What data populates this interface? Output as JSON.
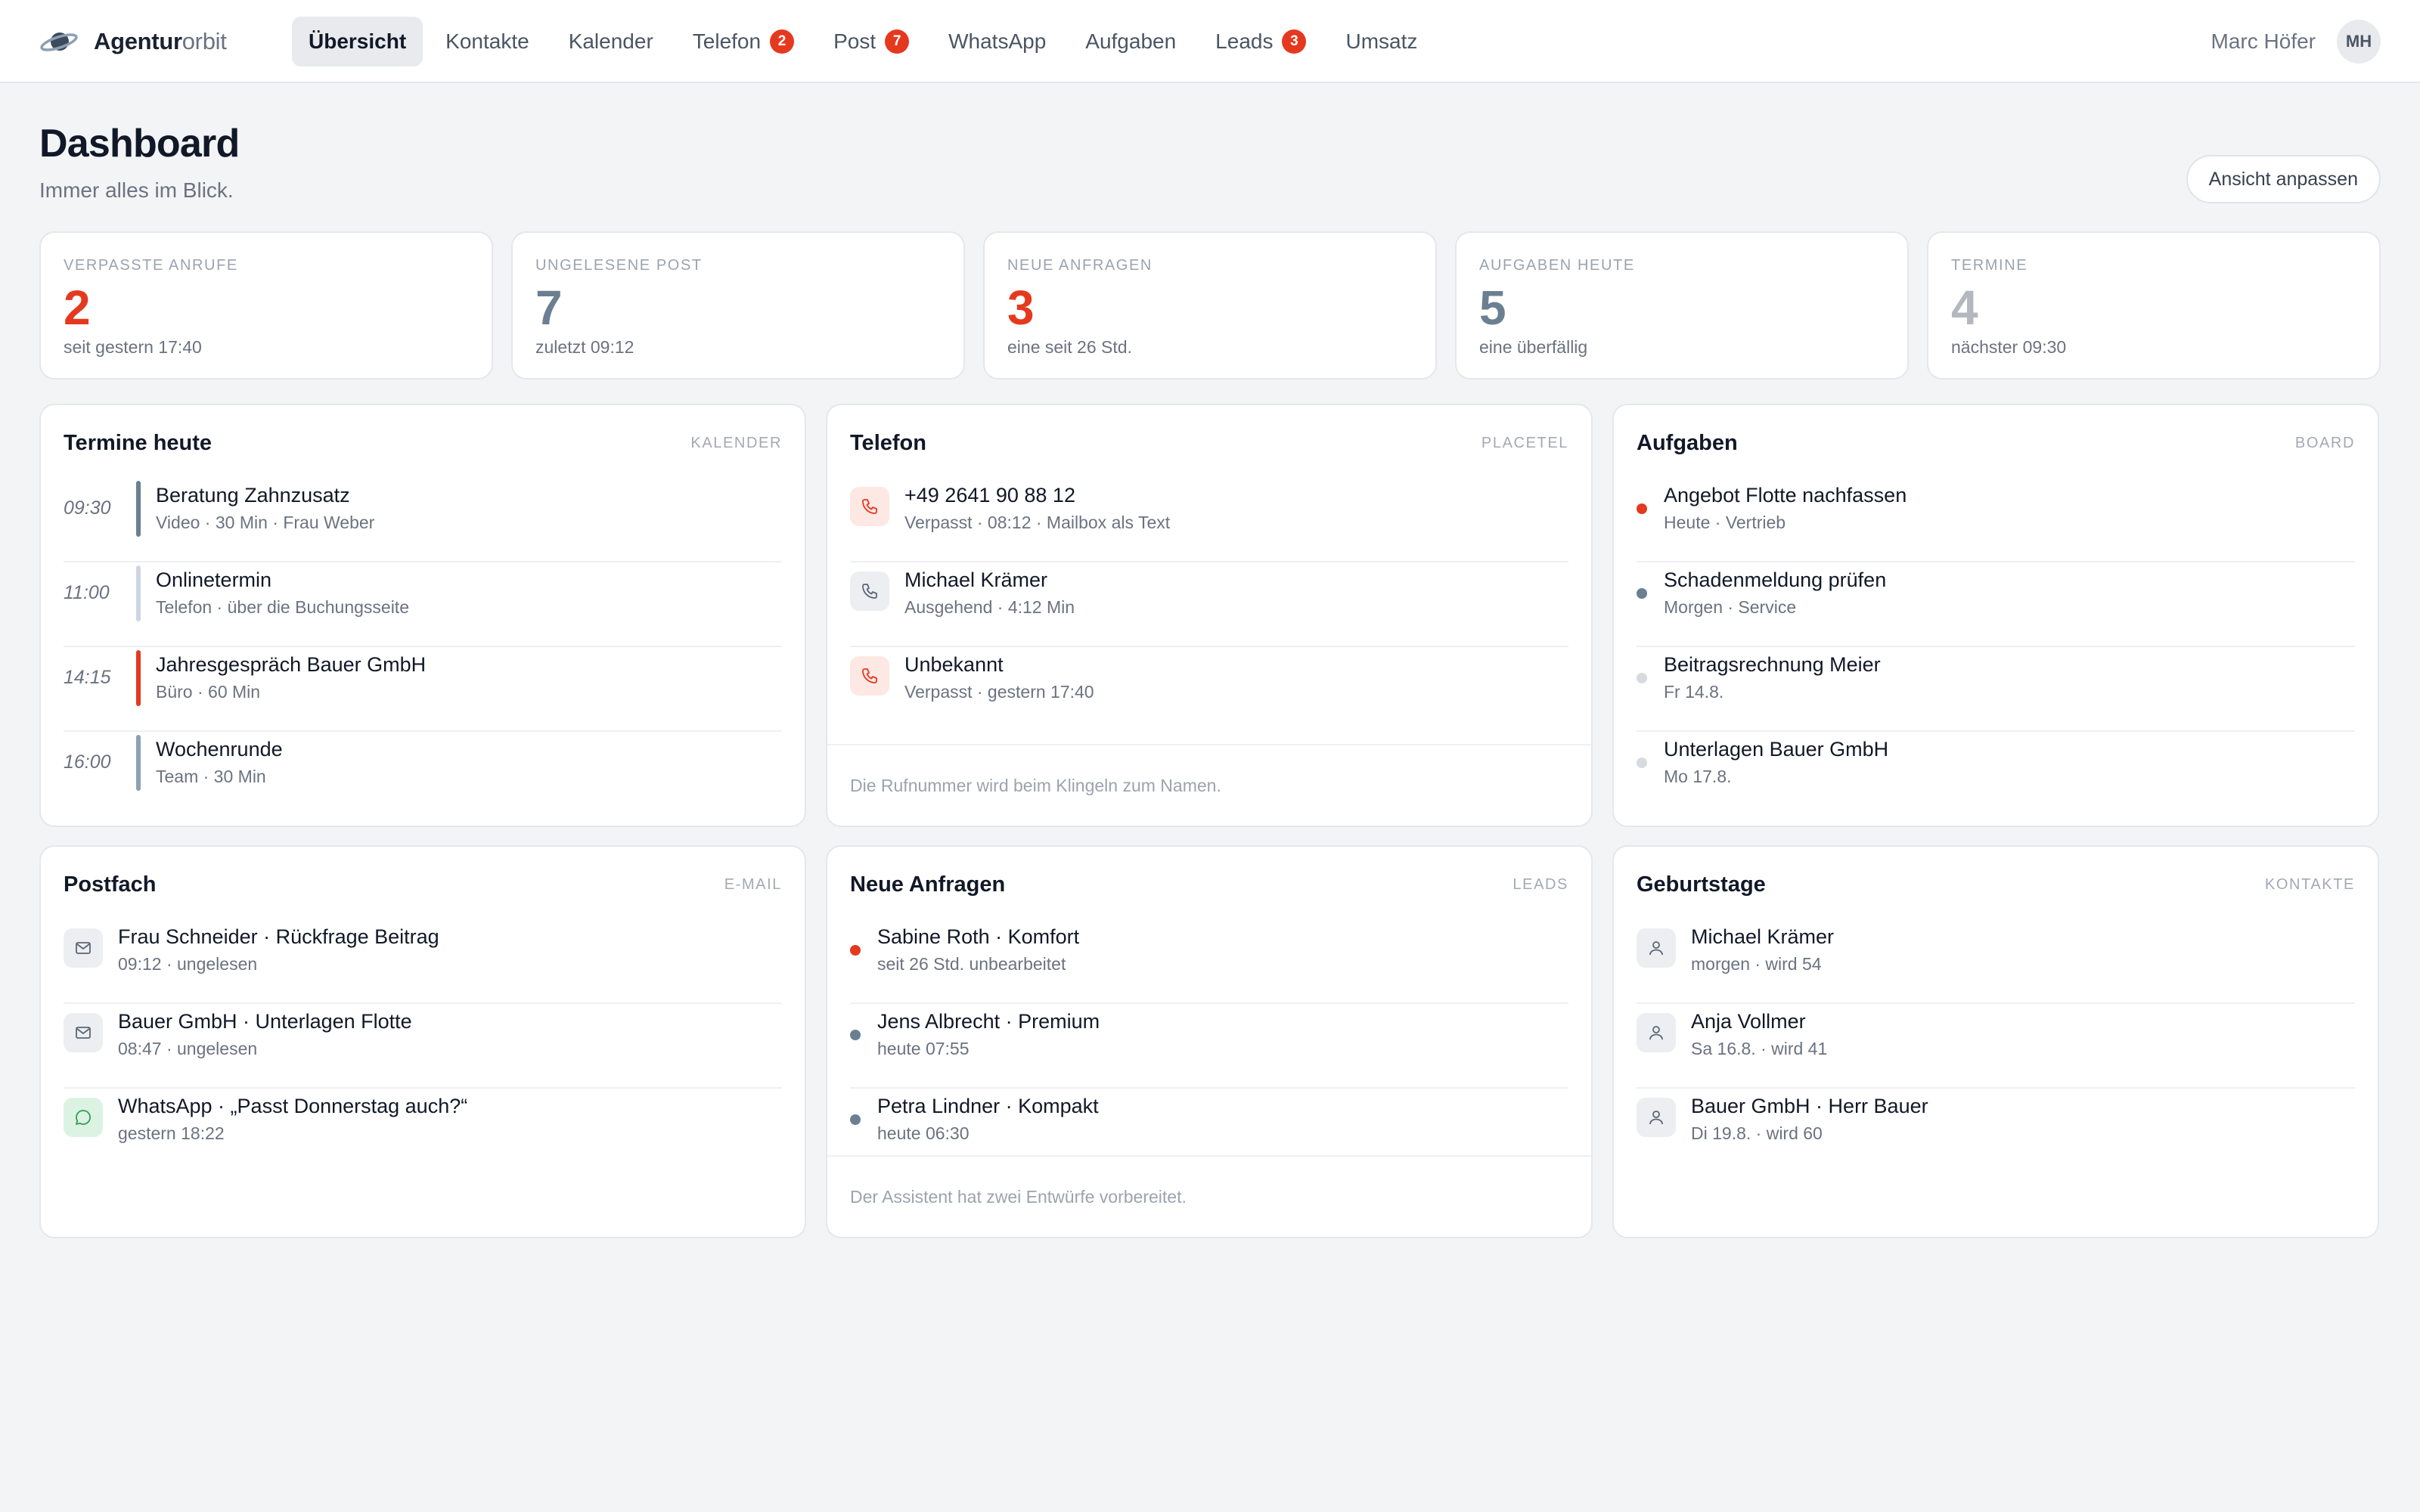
{
  "brand": {
    "bold": "Agentur",
    "light": "orbit"
  },
  "nav": [
    {
      "label": "Übersicht",
      "active": true
    },
    {
      "label": "Kontakte"
    },
    {
      "label": "Kalender"
    },
    {
      "label": "Telefon",
      "badge": "2"
    },
    {
      "label": "Post",
      "badge": "7"
    },
    {
      "label": "WhatsApp"
    },
    {
      "label": "Aufgaben"
    },
    {
      "label": "Leads",
      "badge": "3"
    },
    {
      "label": "Umsatz"
    }
  ],
  "user": {
    "name": "Marc Höfer",
    "initials": "MH"
  },
  "header": {
    "title": "Dashboard",
    "subtitle": "Immer alles im Blick.",
    "customize_label": "Ansicht anpassen"
  },
  "stats": [
    {
      "label": "Verpasste Anrufe",
      "value": "2",
      "note": "seit gestern 17:40",
      "color": "#e5391f"
    },
    {
      "label": "Ungelesene Post",
      "value": "7",
      "note": "zuletzt 09:12",
      "color": "#6b7f92"
    },
    {
      "label": "Neue Anfragen",
      "value": "3",
      "note": "eine seit 26 Std.",
      "color": "#e5391f"
    },
    {
      "label": "Aufgaben heute",
      "value": "5",
      "note": "eine überfällig",
      "color": "#6b7f92"
    },
    {
      "label": "Termine",
      "value": "4",
      "note": "nächster 09:30",
      "color": "#b3b8c0"
    }
  ],
  "appointments": {
    "title": "Termine heute",
    "tag": "Kalender",
    "items": [
      {
        "time": "09:30",
        "title": "Beratung Zahnzusatz",
        "sub": "Video · 30 Min · Frau Weber",
        "color": "#6b7f92"
      },
      {
        "time": "11:00",
        "title": "Onlinetermin",
        "sub": "Telefon · über die Buchungsseite",
        "color": "#cdd5e6"
      },
      {
        "time": "14:15",
        "title": "Jahresgespräch Bauer GmbH",
        "sub": "Büro · 60 Min",
        "color": "#e5391f"
      },
      {
        "time": "16:00",
        "title": "Wochenrunde",
        "sub": "Team · 30 Min",
        "color": "#8ea0b3"
      }
    ]
  },
  "phone": {
    "title": "Telefon",
    "tag": "Placetel",
    "items": [
      {
        "title": "+49 2641 90 88 12",
        "sub": "Verpasst · 08:12 · Mailbox als Text",
        "icon": "phone-missed-icon",
        "missed": true
      },
      {
        "title": "Michael Krämer",
        "sub": "Ausgehend · 4:12 Min",
        "icon": "phone-icon",
        "missed": false
      },
      {
        "title": "Unbekannt",
        "sub": "Verpasst · gestern 17:40",
        "icon": "phone-missed-icon",
        "missed": true
      }
    ],
    "footer": "Die Rufnummer wird beim Klingeln zum Namen."
  },
  "tasks": {
    "title": "Aufgaben",
    "tag": "Board",
    "items": [
      {
        "title": "Angebot Flotte nachfassen",
        "sub": "Heute · Vertrieb",
        "color": "#e5391f"
      },
      {
        "title": "Schadenmeldung prüfen",
        "sub": "Morgen · Service",
        "color": "#6b7f92"
      },
      {
        "title": "Beitragsrechnung Meier",
        "sub": "Fr 14.8.",
        "color": "#d7dbe0"
      },
      {
        "title": "Unterlagen Bauer GmbH",
        "sub": "Mo 17.8.",
        "color": "#d7dbe0"
      }
    ]
  },
  "inbox": {
    "title": "Postfach",
    "tag": "E-Mail",
    "items": [
      {
        "title": "Frau Schneider · Rückfrage Beitrag",
        "sub": "09:12 · ungelesen",
        "icon": "mail-icon"
      },
      {
        "title": "Bauer GmbH · Unterlagen Flotte",
        "sub": "08:47 · ungelesen",
        "icon": "mail-icon"
      },
      {
        "title": "WhatsApp · „Passt Donnerstag auch?“",
        "sub": "gestern 18:22",
        "icon": "chat-bubble-icon"
      }
    ]
  },
  "leads": {
    "title": "Neue Anfragen",
    "tag": "Leads",
    "items": [
      {
        "title": "Sabine Roth · Komfort",
        "sub": "seit 26 Std. unbearbeitet",
        "color": "#e5391f"
      },
      {
        "title": "Jens Albrecht · Premium",
        "sub": "heute 07:55",
        "color": "#6b7f92"
      },
      {
        "title": "Petra Lindner · Kompakt",
        "sub": "heute 06:30",
        "color": "#6b7f92"
      }
    ],
    "footer": "Der Assistent hat zwei Entwürfe vorbereitet."
  },
  "birthdays": {
    "title": "Geburtstage",
    "tag": "Kontakte",
    "items": [
      {
        "title": "Michael Krämer",
        "sub": "morgen · wird 54",
        "icon": "person-icon"
      },
      {
        "title": "Anja Vollmer",
        "sub": "Sa 16.8. · wird 41",
        "icon": "person-icon"
      },
      {
        "title": "Bauer GmbH · Herr Bauer",
        "sub": "Di 19.8. · wird 60",
        "icon": "person-icon"
      }
    ]
  }
}
